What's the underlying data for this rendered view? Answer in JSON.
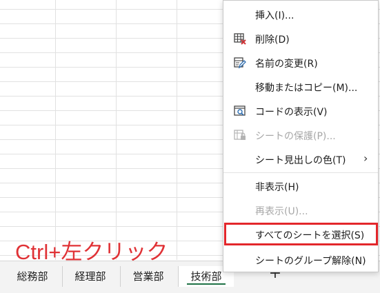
{
  "annotation": {
    "text": "Ctrl+左クリック",
    "color": "#e03236"
  },
  "sheet_tabs": [
    {
      "label": "総務部",
      "active": false
    },
    {
      "label": "経理部",
      "active": false
    },
    {
      "label": "営業部",
      "active": false
    },
    {
      "label": "技術部",
      "active": true
    }
  ],
  "add_sheet": {
    "label": "+"
  },
  "context_menu": {
    "items": [
      {
        "label": "挿入(I)...",
        "icon": "",
        "enabled": true
      },
      {
        "label": "削除(D)",
        "icon": "delete-sheet-icon",
        "enabled": true
      },
      {
        "label": "名前の変更(R)",
        "icon": "rename-sheet-icon",
        "enabled": true
      },
      {
        "label": "移動またはコピー(M)...",
        "icon": "",
        "enabled": true
      },
      {
        "label": "コードの表示(V)",
        "icon": "view-code-icon",
        "enabled": true
      },
      {
        "label": "シートの保護(P)...",
        "icon": "protect-sheet-icon",
        "enabled": false
      },
      {
        "label": "シート見出しの色(T)",
        "icon": "",
        "enabled": true,
        "submenu": true
      },
      {
        "label": "非表示(H)",
        "icon": "",
        "enabled": true
      },
      {
        "label": "再表示(U)...",
        "icon": "",
        "enabled": false
      },
      {
        "label": "すべてのシートを選択(S)",
        "icon": "",
        "enabled": true,
        "highlighted": true
      },
      {
        "label": "シートのグループ解除(N)",
        "icon": "",
        "enabled": true
      }
    ],
    "submenu_glyph": "›",
    "highlight_color": "#e3262b"
  }
}
